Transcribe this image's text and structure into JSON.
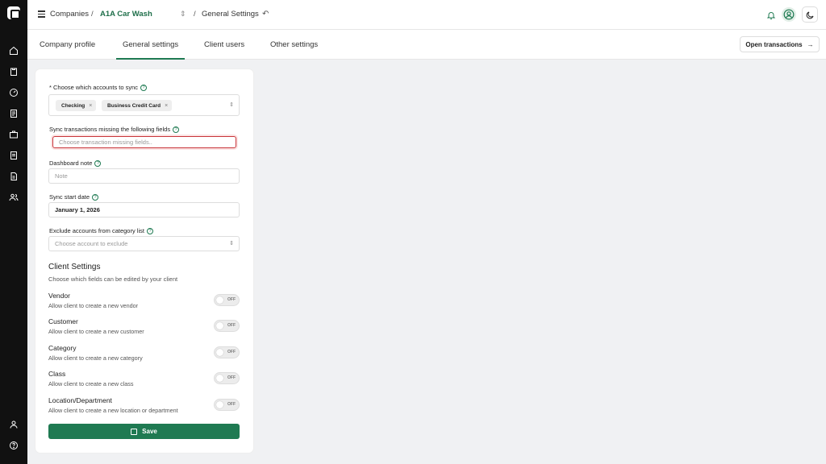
{
  "colors": {
    "accent": "#1f7a52",
    "focus_border": "#c8353a",
    "rail": "#111111"
  },
  "breadcrumb": {
    "root": "Companies",
    "company": "A1A Car Wash",
    "page": "General Settings"
  },
  "tabs": [
    {
      "label": "Company profile"
    },
    {
      "label": "General settings"
    },
    {
      "label": "Client users"
    },
    {
      "label": "Other settings"
    }
  ],
  "open_transactions_label": "Open transactions",
  "form": {
    "accounts_label": "* Choose which accounts to sync",
    "accounts_chips": [
      "Checking",
      "Business Credit Card"
    ],
    "missing_label": "Sync transactions missing the following fields",
    "missing_placeholder": "Choose transaction missing fields..",
    "note_label": "Dashboard note",
    "note_placeholder": "Note",
    "start_label": "Sync start date",
    "start_value": "January 1, 2026",
    "exclude_label": "Exclude accounts from category list",
    "exclude_placeholder": "Choose account to exclude"
  },
  "client_settings": {
    "title": "Client Settings",
    "subtitle": "Choose which fields can be edited by your client",
    "items": [
      {
        "title": "Vendor",
        "desc": "Allow client to create a new vendor",
        "state": "OFF"
      },
      {
        "title": "Customer",
        "desc": "Allow client to create a new customer",
        "state": "OFF"
      },
      {
        "title": "Category",
        "desc": "Allow client to create a new category",
        "state": "OFF"
      },
      {
        "title": "Class",
        "desc": "Allow client to create a new class",
        "state": "OFF"
      },
      {
        "title": "Location/Department",
        "desc": "Allow client to create a new location or department",
        "state": "OFF"
      }
    ]
  },
  "save_label": "Save"
}
